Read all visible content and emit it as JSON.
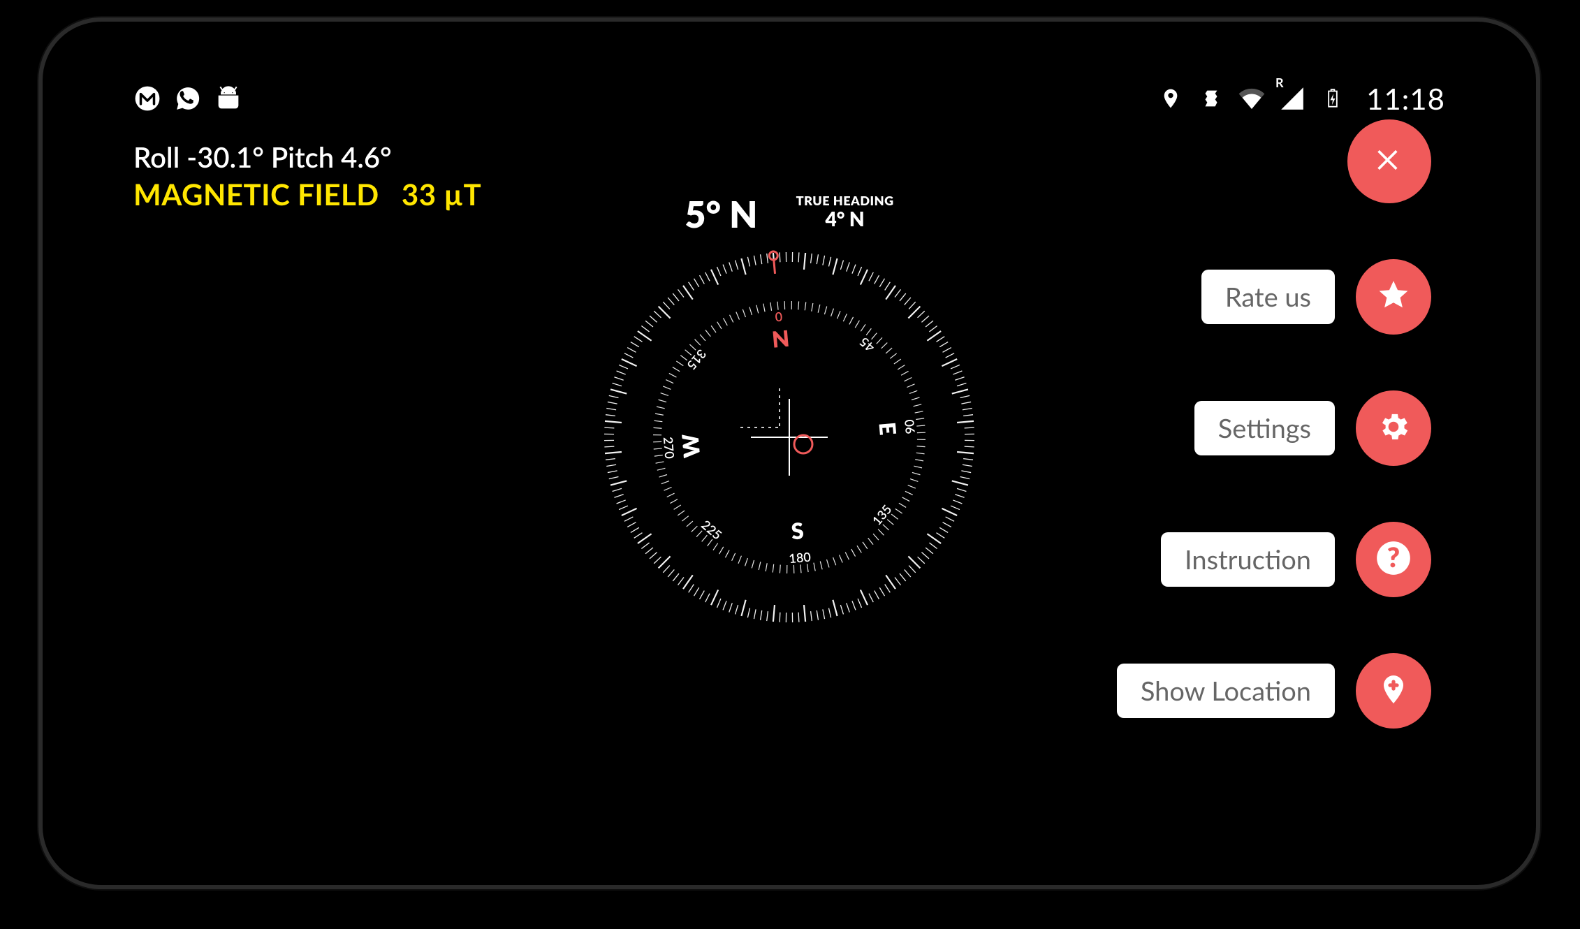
{
  "status": {
    "time": "11:18",
    "roaming_letter": "R"
  },
  "readouts": {
    "roll_label": "Roll",
    "roll_value": "-30.1°",
    "pitch_label": "Pitch",
    "pitch_value": "4.6°",
    "field_label": "MAGNETIC FIELD",
    "field_value": "33 µT"
  },
  "heading": {
    "main": "5° N",
    "true_label": "TRUE HEADING",
    "true_value": "4° N",
    "compass_rotation_deg": -5,
    "cardinals": {
      "N": "N",
      "E": "E",
      "S": "S",
      "W": "W"
    },
    "degree_labels": [
      "0",
      "45",
      "90",
      "135",
      "180",
      "225",
      "270",
      "315"
    ]
  },
  "menu": {
    "rate": "Rate us",
    "settings": "Settings",
    "instruction": "Instruction",
    "show_location": "Show Location"
  },
  "colors": {
    "accent": "#f05a5a",
    "field_text": "#ffe600"
  }
}
